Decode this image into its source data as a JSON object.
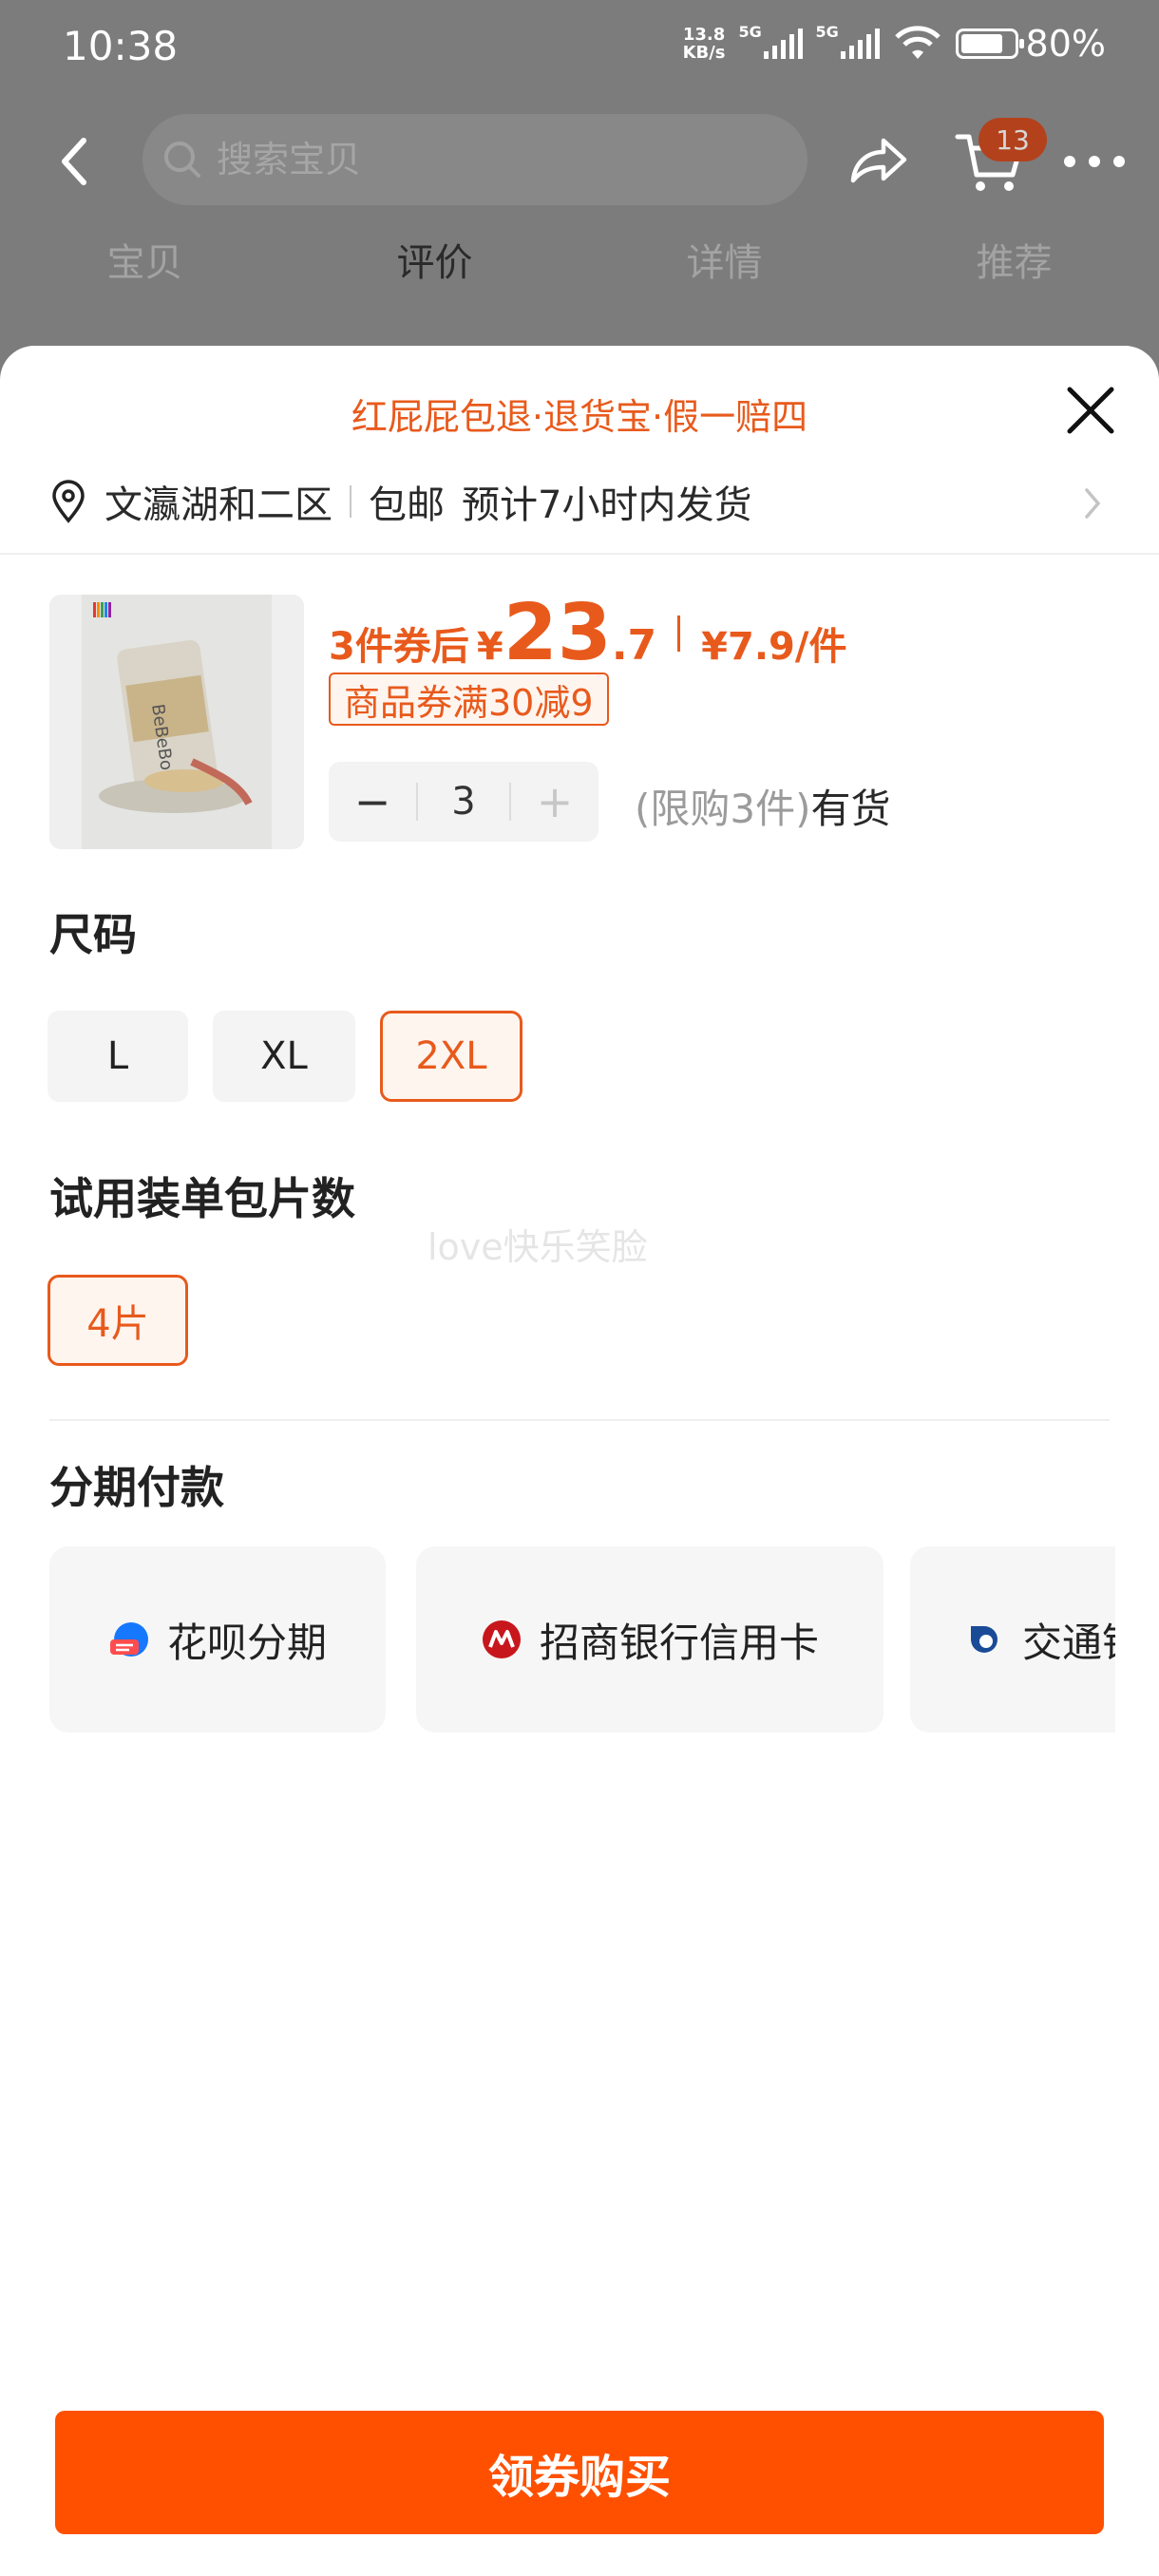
{
  "status_bar": {
    "time": "10:38",
    "net_speed_value": "13.8",
    "net_speed_unit": "KB/s",
    "sim1_type": "5G",
    "sim2_type": "5G",
    "battery_percent": "80%",
    "battery_level": 0.8
  },
  "header": {
    "search_placeholder": "搜索宝贝",
    "cart_count": "13",
    "tabs": [
      "宝贝",
      "评价",
      "详情",
      "推荐"
    ],
    "active_tab": "评价"
  },
  "sheet": {
    "guarantee": "红屁屁包退·退货宝·假一赔四",
    "shipping": {
      "address": "文瀛湖和二区",
      "free_shipping": "包邮",
      "eta": "预计7小时内发货"
    },
    "product": {
      "price_label": "3件券后",
      "currency": "¥",
      "price_int": "23",
      "price_dec": ".7",
      "unit_price": "¥7.9/件",
      "coupon": "商品券满30减9",
      "quantity": "3",
      "minus": "−",
      "plus": "+",
      "limit": "(限购3件)",
      "availability": "有货",
      "brand_text": "BeBeBo"
    },
    "size": {
      "title": "尺码",
      "options": [
        "L",
        "XL",
        "2XL"
      ],
      "selected": "2XL"
    },
    "trial_pack": {
      "title": "试用装单包片数",
      "options": [
        "4片"
      ],
      "selected": "4片"
    },
    "watermark": "love快乐笑脸",
    "installment": {
      "title": "分期付款",
      "options": [
        "花呗分期",
        "招商银行信用卡",
        "交通银行信用卡"
      ]
    },
    "buy_button": "领券购买"
  },
  "colors": {
    "accent": "#e85a1c",
    "buy_button": "#ff5000",
    "overlay_dim": "#7c7c7c",
    "cmb_red": "#c8161d",
    "bocom_blue": "#1a4b97",
    "huabei_blue": "#1677ff"
  },
  "icons": [
    "back-arrow-icon",
    "search-icon",
    "share-icon",
    "cart-icon",
    "more-icon",
    "close-icon",
    "location-pin-icon",
    "chevron-right-icon",
    "huabei-logo-icon",
    "cmb-logo-icon",
    "bocom-logo-icon"
  ]
}
